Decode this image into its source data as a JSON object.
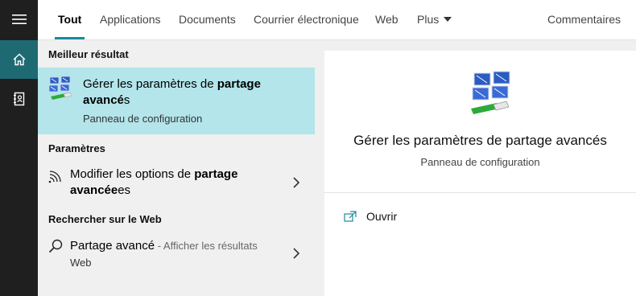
{
  "tabs": {
    "all": "Tout",
    "apps": "Applications",
    "documents": "Documents",
    "email": "Courrier électronique",
    "web": "Web",
    "more": "Plus",
    "feedback": "Commentaires"
  },
  "results": {
    "best_header": "Meilleur résultat",
    "best": {
      "title_pre": "Gérer les paramètres de ",
      "title_bold1": "partage",
      "title_bold2": "avancé",
      "title_post": "s",
      "subtitle": "Panneau de configuration",
      "icon": "network-sharing-icon"
    },
    "settings_header": "Paramètres",
    "setting_item": {
      "title_pre": "Modifier les options de ",
      "title_bold1": "partage",
      "title_bold2": "avancée",
      "title_post": "es",
      "icon": "wifi-signal-icon"
    },
    "web_header": "Rechercher sur le Web",
    "web_item": {
      "title": "Partage avancé",
      "hint": " - Afficher les résultats",
      "subtitle": "Web",
      "icon": "search-icon"
    }
  },
  "preview": {
    "title": "Gérer les paramètres de partage avancés",
    "subtitle": "Panneau de configuration",
    "action_open": "Ouvrir",
    "icon": "network-sharing-icon"
  },
  "colors": {
    "rail": "#1f1f1f",
    "rail_active": "#1e6a73",
    "selection": "#b3e5eb",
    "accent": "#1a8aa0"
  }
}
